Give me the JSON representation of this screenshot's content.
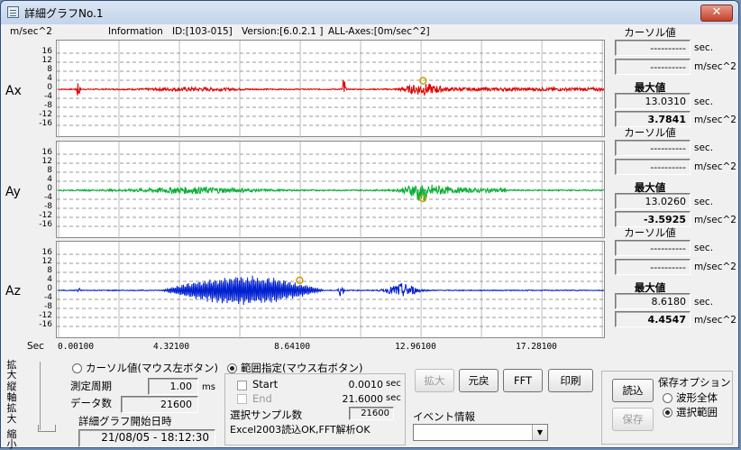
{
  "window": {
    "title": "詳細グラフNo.1",
    "close": "✕"
  },
  "info": {
    "y_unit": "m/sec^2",
    "info_label": "Information",
    "id": "ID:[103-015]",
    "version": "Version:[6.0.2.1 ]",
    "axes": "ALL-Axes:[0m/sec^2]"
  },
  "y_ticks": [
    "16",
    "12",
    "8",
    "4",
    "0",
    "-4",
    "-8",
    "-12",
    "-16"
  ],
  "x_axis": {
    "label": "Sec",
    "ticks": [
      "0.00100",
      "4.32100",
      "8.64100",
      "12.96100",
      "17.28100"
    ]
  },
  "channels": [
    {
      "name": "Ax",
      "color": "#e00000",
      "cursor_label": "カーソル値",
      "cursor_sec": "----------",
      "cursor_val": "----------",
      "max_label": "最大値",
      "max_sec": "13.0310",
      "max_val": "3.7841"
    },
    {
      "name": "Ay",
      "color": "#00b030",
      "cursor_label": "カーソル値",
      "cursor_sec": "----------",
      "cursor_val": "----------",
      "max_label": "最大値",
      "max_sec": "13.0260",
      "max_val": "-3.5925"
    },
    {
      "name": "Az",
      "color": "#0020d0",
      "cursor_label": "カーソル値",
      "cursor_sec": "----------",
      "cursor_val": "----------",
      "max_label": "最大値",
      "max_sec": "8.6180",
      "max_val": "4.4547"
    }
  ],
  "units": {
    "sec": "sec.",
    "acc": "m/sec^2"
  },
  "chart_data": [
    {
      "type": "line",
      "title": "Ax",
      "ylabel": "m/sec^2",
      "xlabel": "Sec",
      "xlim": [
        0.001,
        19.5
      ],
      "ylim": [
        -20,
        20
      ],
      "peak": {
        "x": 13.031,
        "y": 3.7841
      }
    },
    {
      "type": "line",
      "title": "Ay",
      "ylabel": "m/sec^2",
      "xlabel": "Sec",
      "xlim": [
        0.001,
        19.5
      ],
      "ylim": [
        -20,
        20
      ],
      "peak": {
        "x": 13.026,
        "y": -3.5925
      }
    },
    {
      "type": "line",
      "title": "Az",
      "ylabel": "m/sec^2",
      "xlabel": "Sec",
      "xlim": [
        0.001,
        19.5
      ],
      "ylim": [
        -20,
        20
      ],
      "peak": {
        "x": 8.618,
        "y": 4.4547
      }
    }
  ],
  "zoom_axis": {
    "top": "拡大",
    "middle": "縦軸拡大",
    "bottom": "縮小"
  },
  "cursor_mode": {
    "label": "カーソル値(マウス左ボタン)",
    "period_label": "測定周期",
    "period_value": "1.00",
    "period_unit": "ms",
    "count_label": "データ数",
    "count_value": "21600",
    "start_label": "詳細グラフ開始日時",
    "start_value": "21/08/05 - 18:12:30"
  },
  "range_mode": {
    "label": "範囲指定(マウス右ボタン)",
    "start_label": "Start",
    "start_value": "0.0010",
    "end_label": "End",
    "end_value": "21.6000",
    "unit": "sec",
    "samples_label": "選択サンプル数",
    "samples_value": "21600",
    "status": "Excel2003読込OK,FFT解析OK"
  },
  "buttons": {
    "zoom": "拡大",
    "reset": "元戻",
    "fft": "FFT",
    "print": "印刷",
    "load": "読込",
    "save": "保存"
  },
  "event": {
    "label": "イベント情報",
    "value": ""
  },
  "save_option": {
    "label": "保存オプション",
    "all": "波形全体",
    "range": "選択範囲"
  }
}
